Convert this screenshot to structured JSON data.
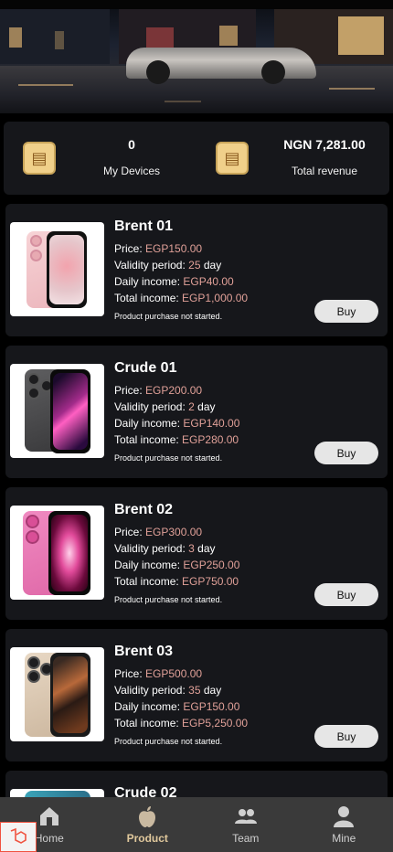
{
  "stats": {
    "devices_value": "0",
    "devices_label": "My Devices",
    "revenue_value": "NGN 7,281.00",
    "revenue_label": "Total revenue"
  },
  "labels": {
    "price": "Price: ",
    "validity": "Validity period: ",
    "validity_unit": " day",
    "daily": "Daily income: ",
    "total": "Total income: ",
    "buy": "Buy"
  },
  "products": [
    {
      "name": "Brent 01",
      "price": "EGP150.00",
      "validity": "25",
      "daily": "EGP40.00",
      "total": "EGP1,000.00",
      "status": "Product purchase not started."
    },
    {
      "name": "Crude 01",
      "price": "EGP200.00",
      "validity": "2",
      "daily": "EGP140.00",
      "total": "EGP280.00",
      "status": "Product purchase not started."
    },
    {
      "name": "Brent 02",
      "price": "EGP300.00",
      "validity": "3",
      "daily": "EGP250.00",
      "total": "EGP750.00",
      "status": "Product purchase not started."
    },
    {
      "name": "Brent 03",
      "price": "EGP500.00",
      "validity": "35",
      "daily": "EGP150.00",
      "total": "EGP5,250.00",
      "status": "Product purchase not started."
    },
    {
      "name": "Crude 02"
    }
  ],
  "tabs": [
    {
      "label": "Home",
      "icon": "home-icon"
    },
    {
      "label": "Product",
      "icon": "apple-icon",
      "active": true
    },
    {
      "label": "Team",
      "icon": "team-icon"
    },
    {
      "label": "Mine",
      "icon": "user-icon"
    }
  ],
  "colors": {
    "value_accent": "#e0a098",
    "active_tab": "#e0c89c",
    "card_bg": "#16171b"
  }
}
